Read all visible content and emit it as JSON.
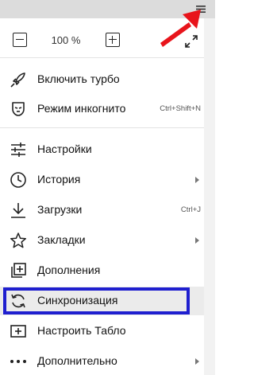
{
  "zoom": {
    "decrease_label": "−",
    "value": "100 %",
    "increase_label": "+",
    "fullscreen_icon": "expand-arrows-icon"
  },
  "menu": {
    "items": [
      {
        "id": "turbo",
        "icon": "rocket-icon",
        "label": "Включить турбо",
        "shortcut": "",
        "submenu": false
      },
      {
        "id": "incognito",
        "icon": "incognito-mask-icon",
        "label": "Режим инкогнито",
        "shortcut": "Ctrl+Shift+N",
        "submenu": false
      },
      {
        "id": "settings",
        "icon": "sliders-icon",
        "label": "Настройки",
        "shortcut": "",
        "submenu": false
      },
      {
        "id": "history",
        "icon": "clock-icon",
        "label": "История",
        "shortcut": "",
        "submenu": true
      },
      {
        "id": "downloads",
        "icon": "download-icon",
        "label": "Загрузки",
        "shortcut": "Ctrl+J",
        "submenu": false
      },
      {
        "id": "bookmarks",
        "icon": "star-icon",
        "label": "Закладки",
        "shortcut": "",
        "submenu": true
      },
      {
        "id": "extensions",
        "icon": "extensions-icon",
        "label": "Дополнения",
        "shortcut": "",
        "submenu": false
      },
      {
        "id": "sync",
        "icon": "sync-icon",
        "label": "Синхронизация",
        "shortcut": "",
        "submenu": false
      },
      {
        "id": "tableau",
        "icon": "add-tile-icon",
        "label": "Настроить Табло",
        "shortcut": "",
        "submenu": false
      },
      {
        "id": "more",
        "icon": "more-dots-icon",
        "label": "Дополнительно",
        "shortcut": "",
        "submenu": true
      }
    ]
  },
  "colors": {
    "highlight_border": "#1f1fcf",
    "annotation_arrow": "#e8141b",
    "hover_background": "#ebebeb"
  }
}
